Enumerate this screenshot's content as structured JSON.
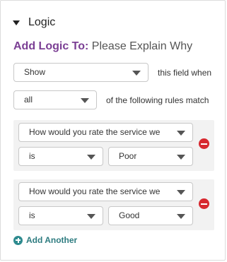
{
  "header": {
    "title": "Logic"
  },
  "target": {
    "label": "Add Logic To:",
    "value": "Please Explain Why"
  },
  "action": {
    "selected": "Show",
    "suffix": "this field when"
  },
  "match": {
    "selected": "all",
    "suffix": "of the following rules match"
  },
  "rules": [
    {
      "field": "How would you rate the service we",
      "operator": "is",
      "value": "Poor"
    },
    {
      "field": "How would you rate the service we",
      "operator": "is",
      "value": "Good"
    }
  ],
  "add_another": {
    "label": "Add Another"
  },
  "colors": {
    "accent_purple": "#7b3f94",
    "remove_red": "#d7282f",
    "add_teal": "#2e8b8f"
  },
  "icons": {
    "collapse": "caret-down-icon",
    "remove": "minus-circle-icon",
    "add": "plus-circle-icon"
  }
}
